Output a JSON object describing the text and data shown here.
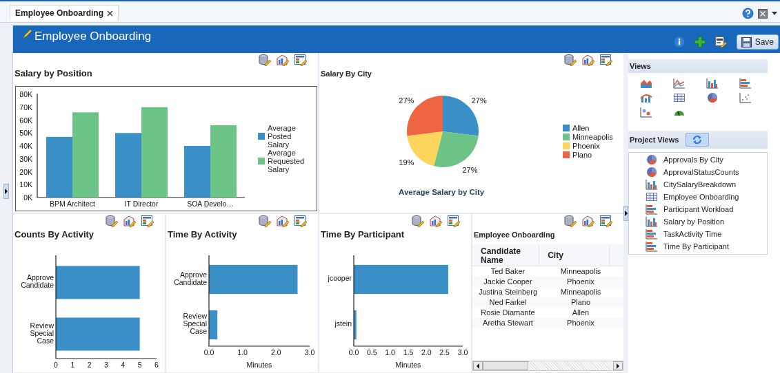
{
  "tab": {
    "label": "Employee Onboarding",
    "selected": true
  },
  "header": {
    "title": "Employee Onboarding",
    "save_label": "Save"
  },
  "panels": [
    {
      "kind": "chart",
      "title": "Salary by Position",
      "chart_data": {
        "type": "bar",
        "categories": [
          "BPM Architect",
          "IT Director",
          "SOA Develo…"
        ],
        "series": [
          {
            "name": "Average Posted Salary",
            "color": "#3a8fc6",
            "values": [
              47000,
              50000,
              40000
            ]
          },
          {
            "name": "Average Requested Salary",
            "color": "#6cc486",
            "values": [
              66000,
              70000,
              56000
            ]
          }
        ],
        "ylim": [
          0,
          80000
        ],
        "yticks": [
          {
            "value": 0,
            "label": "0K"
          },
          {
            "value": 10000,
            "label": "10K"
          },
          {
            "value": 20000,
            "label": "20K"
          },
          {
            "value": 30000,
            "label": "30K"
          },
          {
            "value": 40000,
            "label": "40K"
          },
          {
            "value": 50000,
            "label": "50K"
          },
          {
            "value": 60000,
            "label": "60K"
          },
          {
            "value": 70000,
            "label": "70K"
          },
          {
            "value": 80000,
            "label": "80K"
          }
        ]
      }
    },
    {
      "kind": "chart",
      "title": "Salary By City",
      "chart_data": {
        "type": "pie",
        "title": "Average Salary by City",
        "legend": "right",
        "categories": [
          "Allen",
          "Minneapolis",
          "Phoenix",
          "Plano"
        ],
        "values": [
          27,
          27,
          19,
          27
        ],
        "colors": [
          "#3a8fc6",
          "#6cc486",
          "#fdd55a",
          "#ee6541"
        ],
        "value_labels": [
          "27%",
          "27%",
          "19%",
          "27%"
        ]
      }
    },
    {
      "kind": "chart",
      "title": "Counts By Activity",
      "chart_data": {
        "type": "bar",
        "orientation": "horizontal",
        "categories": [
          "Approve Candidate",
          "Review Special Case"
        ],
        "series": [
          {
            "color": "#3a8fc6",
            "values": [
              5,
              5
            ]
          }
        ],
        "xlim": [
          0,
          6
        ],
        "xticks": [
          0,
          1,
          2,
          3,
          4,
          5,
          6
        ]
      }
    },
    {
      "kind": "chart",
      "title": "Time By Activity",
      "chart_data": {
        "type": "bar",
        "orientation": "horizontal",
        "categories": [
          "Approve Candidate",
          "Review Special Case"
        ],
        "series": [
          {
            "color": "#3a8fc6",
            "values": [
              2.64,
              0.25
            ]
          }
        ],
        "xlim": [
          0,
          3
        ],
        "xlabel": "Minutes",
        "xticks": [
          {
            "value": 0,
            "label": "0.0"
          },
          {
            "value": 1,
            "label": "1.0"
          },
          {
            "value": 2,
            "label": "2.0"
          },
          {
            "value": 3,
            "label": "3.0"
          }
        ]
      }
    },
    {
      "kind": "chart",
      "title": "Time By Participant",
      "chart_data": {
        "type": "bar",
        "orientation": "horizontal",
        "categories": [
          "jcooper",
          "jstein"
        ],
        "series": [
          {
            "color": "#3a8fc6",
            "values": [
              2.6,
              0.07
            ]
          }
        ],
        "xlim": [
          0,
          3
        ],
        "xlabel": "Minutes",
        "xticks": [
          {
            "value": 0,
            "label": "0.0"
          },
          {
            "value": 0.5,
            "label": "0.5"
          },
          {
            "value": 1,
            "label": "1.0"
          },
          {
            "value": 1.5,
            "label": "1.5"
          },
          {
            "value": 2,
            "label": "2.0"
          },
          {
            "value": 2.5,
            "label": "2.5"
          },
          {
            "value": 3,
            "label": "3.0"
          }
        ]
      }
    },
    {
      "kind": "table",
      "title": "Employee Onboarding",
      "columns": [
        "Candidate Name",
        "City"
      ],
      "rows": [
        {
          "candidate_name": "Ted Baker",
          "city": "Minneapolis"
        },
        {
          "candidate_name": "Jackie Cooper",
          "city": "Phoenix"
        },
        {
          "candidate_name": "Justina Steinberg",
          "city": "Minneapolis"
        },
        {
          "candidate_name": "Ned Farkel",
          "city": "Plano"
        },
        {
          "candidate_name": "Rosie Diamante",
          "city": "Allen"
        },
        {
          "candidate_name": "Aretha Stewart",
          "city": "Phoenix"
        }
      ]
    }
  ],
  "sidebar": {
    "views_title": "Views",
    "project_views_title": "Project Views",
    "project_views": [
      {
        "label": "Approvals By City",
        "kind": "pie"
      },
      {
        "label": "ApprovalStatusCounts",
        "kind": "pie"
      },
      {
        "label": "CitySalaryBreakdown",
        "kind": "bar"
      },
      {
        "label": "Employee Onboarding",
        "kind": "table"
      },
      {
        "label": "Participant Workload",
        "kind": "hbar"
      },
      {
        "label": "Salary by Position",
        "kind": "bar"
      },
      {
        "label": "TaskActivity Time",
        "kind": "hbar"
      },
      {
        "label": "Time By Participant",
        "kind": "hbar"
      }
    ]
  }
}
